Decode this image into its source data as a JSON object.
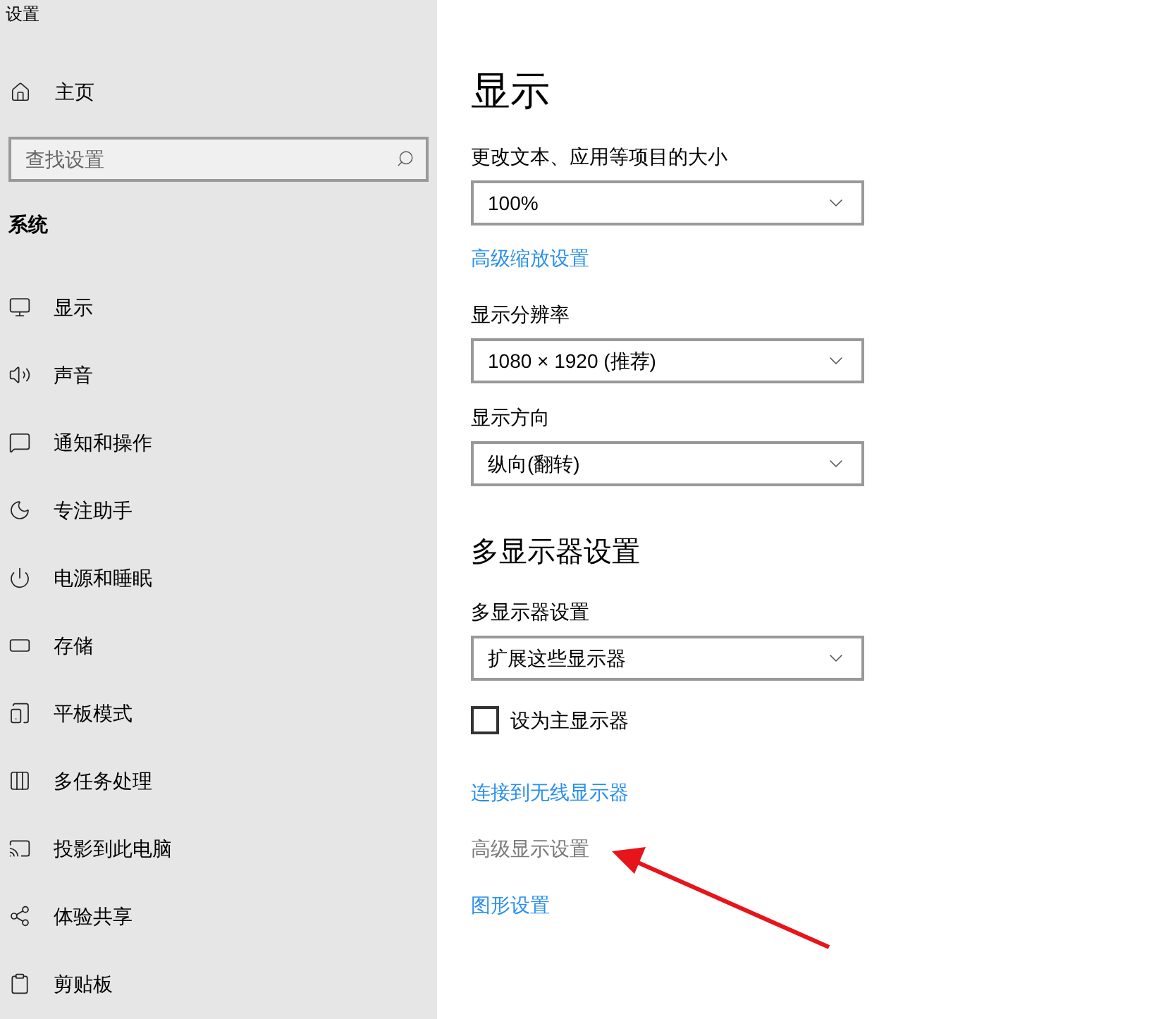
{
  "window": {
    "title": "设置"
  },
  "sidebar": {
    "home": "主页",
    "search": {
      "placeholder": "查找设置"
    },
    "section": "系统",
    "items": [
      {
        "label": "显示"
      },
      {
        "label": "声音"
      },
      {
        "label": "通知和操作"
      },
      {
        "label": "专注助手"
      },
      {
        "label": "电源和睡眠"
      },
      {
        "label": "存储"
      },
      {
        "label": "平板模式"
      },
      {
        "label": "多任务处理"
      },
      {
        "label": "投影到此电脑"
      },
      {
        "label": "体验共享"
      },
      {
        "label": "剪贴板"
      }
    ]
  },
  "main": {
    "items": [
      {
        "kind": "title",
        "text": "显示"
      },
      {
        "kind": "label",
        "text": "更改文本、应用等项目的大小"
      },
      {
        "kind": "dropdown",
        "value": "100%"
      },
      {
        "kind": "link",
        "text": "高级缩放设置",
        "disabled": false
      },
      {
        "kind": "label",
        "text": "显示分辨率"
      },
      {
        "kind": "dropdown",
        "value": "1080 × 1920 (推荐)"
      },
      {
        "kind": "label",
        "text": "显示方向"
      },
      {
        "kind": "dropdown",
        "value": "纵向(翻转)"
      },
      {
        "kind": "heading",
        "text": "多显示器设置"
      },
      {
        "kind": "label",
        "text": "多显示器设置"
      },
      {
        "kind": "dropdown",
        "value": "扩展这些显示器"
      },
      {
        "kind": "checkbox",
        "text": "设为主显示器",
        "checked": false
      },
      {
        "kind": "link",
        "text": "连接到无线显示器",
        "disabled": false
      },
      {
        "kind": "link",
        "text": "高级显示设置",
        "disabled": true
      },
      {
        "kind": "link",
        "text": "图形设置",
        "disabled": false
      }
    ]
  }
}
